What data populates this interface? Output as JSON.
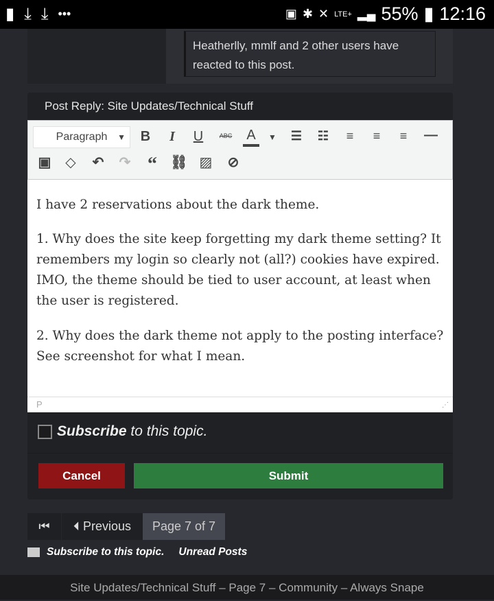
{
  "status_bar": {
    "battery": "55%",
    "time": "12:16",
    "network": "LTE+"
  },
  "post": {
    "reactions": "Heatherlly, mmlf and 2 other users have reacted to this post."
  },
  "reply": {
    "title": "Post Reply: Site Updates/Technical Stuff",
    "format_select": "Paragraph",
    "tool_labels": {
      "bold": "B",
      "italic": "I",
      "underline": "U",
      "strike": "ABC",
      "color": "A",
      "quote": "“"
    },
    "paragraphs": [
      "I have 2 reservations about the dark theme.",
      "1. Why does the site keep forgetting my dark theme setting? It remembers my login so clearly not (all?) cookies have expired. IMO, the theme should be tied to user account, at least when the user is registered.",
      "2. Why does the dark theme not apply to the posting interface? See screenshot for what I mean."
    ],
    "path": "P",
    "subscribe_bold": "Subscribe",
    "subscribe_rest": " to this topic.",
    "cancel": "Cancel",
    "submit": "Submit"
  },
  "pagination": {
    "previous": "Previous",
    "current": "Page 7 of 7"
  },
  "links": {
    "subscribe": "Subscribe to this topic.",
    "unread": "Unread Posts"
  },
  "footer": "Site Updates/Technical Stuff – Page 7 – Community – Always Snape",
  "colors": {
    "cancel": "#8f1415",
    "submit": "#2c7d3e",
    "panel": "#202124"
  }
}
